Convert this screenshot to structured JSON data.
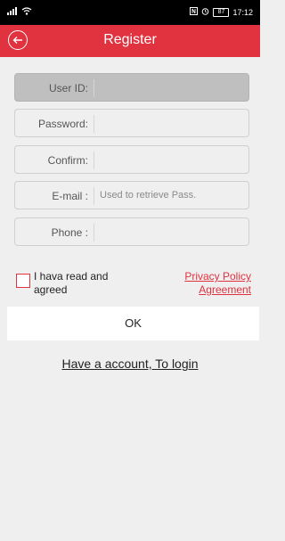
{
  "status_bar": {
    "left_icons": [
      "signal-icon",
      "wifi-icon"
    ],
    "right_icons": [
      "nfc-icon",
      "alarm-icon"
    ],
    "battery": "87",
    "time": "17:12"
  },
  "header": {
    "title": "Register",
    "accent_color": "#e0323f"
  },
  "form": {
    "user_id": {
      "label": "User ID:",
      "value": "",
      "placeholder": ""
    },
    "password": {
      "label": "Password:",
      "value": "",
      "placeholder": ""
    },
    "confirm": {
      "label": "Confirm:",
      "value": "",
      "placeholder": ""
    },
    "email": {
      "label": "E-mail :",
      "value": "",
      "placeholder": "Used to retrieve Pass."
    },
    "phone": {
      "label": "Phone :",
      "value": "",
      "placeholder": ""
    }
  },
  "agreement": {
    "text": "I hava read and agreed",
    "link": "Privacy Policy Agreement",
    "checked": false
  },
  "ok_button": "OK",
  "login_link": "Have a account, To login"
}
